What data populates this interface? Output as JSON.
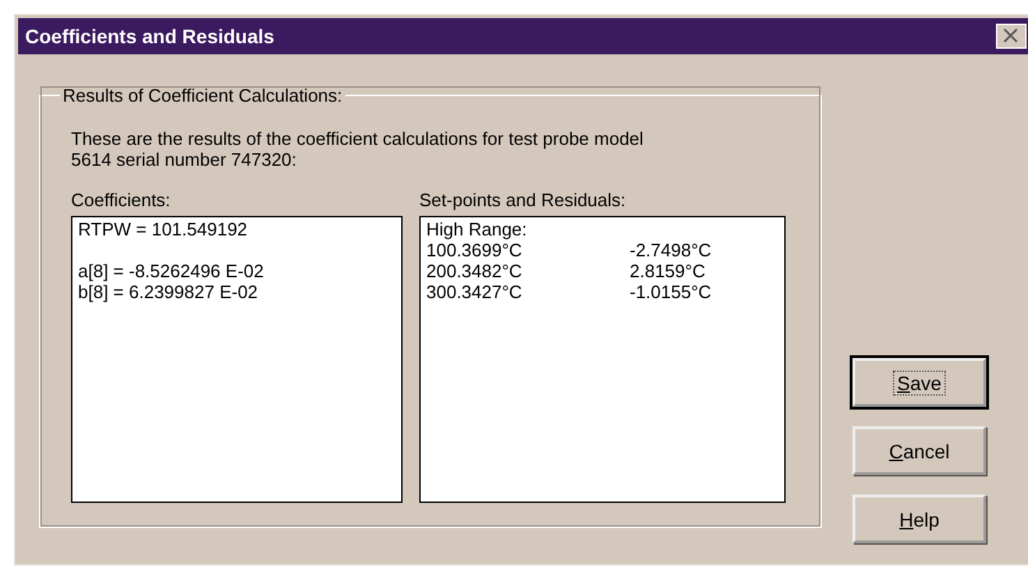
{
  "window": {
    "title": "Coefficients and Residuals"
  },
  "group": {
    "legend": "Results of Coefficient Calculations:",
    "description": "These are the results of the coefficient calculations for test probe model 5614 serial number 747320:"
  },
  "coefficients": {
    "label": "Coefficients:",
    "blocks": [
      {
        "lines": [
          "RTPW = 101.549192"
        ]
      },
      {
        "lines": [
          "a[8] = -8.5262496 E-02",
          "b[8] = 6.2399827 E-02"
        ]
      }
    ]
  },
  "residuals": {
    "label": "Set-points and Residuals:",
    "range": "High Range:",
    "rows": [
      {
        "setpoint": "100.3699°C",
        "residual": "-2.7498°C"
      },
      {
        "setpoint": "200.3482°C",
        "residual": "2.8159°C"
      },
      {
        "setpoint": "300.3427°C",
        "residual": "-1.0155°C"
      }
    ]
  },
  "buttons": [
    {
      "label": "Save",
      "mnemonic": true,
      "default": true,
      "focused": true
    },
    {
      "label": "Cancel",
      "mnemonic": true,
      "default": false,
      "focused": false
    },
    {
      "label": "Help",
      "mnemonic": true,
      "default": false,
      "focused": false
    }
  ]
}
